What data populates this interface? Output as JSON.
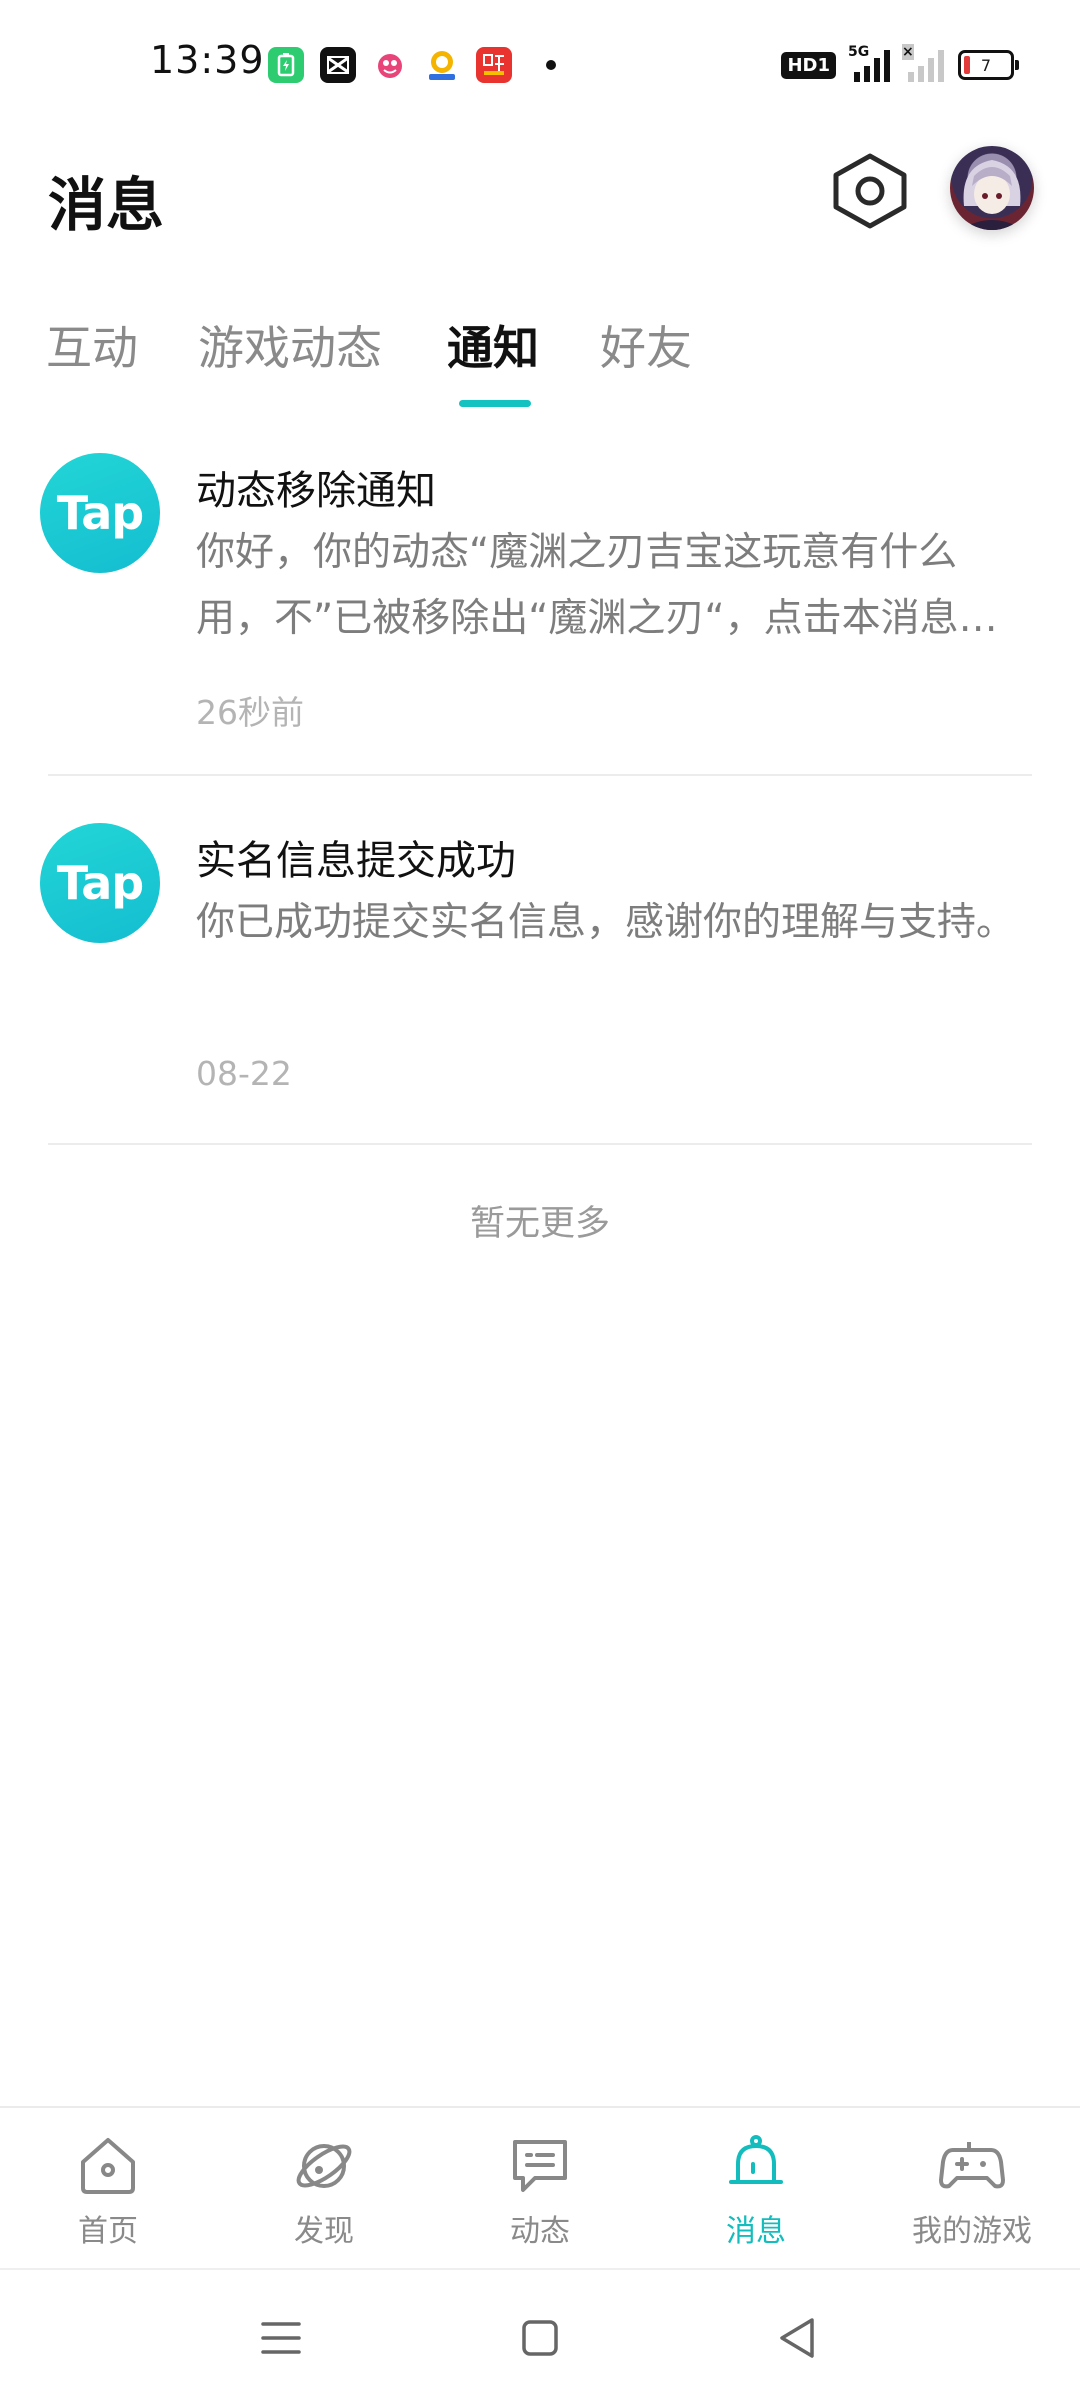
{
  "status_bar": {
    "time": "13:39",
    "network": "5G",
    "hd_label": "HD1",
    "battery_level": "7",
    "notification_icons": [
      "battery-charging-icon",
      "capcut-icon",
      "app-icon",
      "wallet-app-icon",
      "listen-app-icon"
    ]
  },
  "header": {
    "title": "消息"
  },
  "tabs": [
    {
      "label": "互动",
      "active": false
    },
    {
      "label": "游戏动态",
      "active": false
    },
    {
      "label": "通知",
      "active": true
    },
    {
      "label": "好友",
      "active": false
    }
  ],
  "messages": [
    {
      "avatar_text": "Tap",
      "title": "动态移除通知",
      "body": "你好，你的动态“魔渊之刃吉宝这玩意有什么用，不”已被移除出“魔渊之刃“，点击本消息查看详情",
      "time": "26秒前"
    },
    {
      "avatar_text": "Tap",
      "title": "实名信息提交成功",
      "body": "你已成功提交实名信息，感谢你的理解与支持。",
      "time": "08-22"
    }
  ],
  "no_more_text": "暂无更多",
  "bottom_nav": [
    {
      "label": "首页",
      "icon": "home-icon",
      "active": false
    },
    {
      "label": "发现",
      "icon": "planet-icon",
      "active": false
    },
    {
      "label": "动态",
      "icon": "chat-bubble-icon",
      "active": false
    },
    {
      "label": "消息",
      "icon": "bell-icon",
      "active": true
    },
    {
      "label": "我的游戏",
      "icon": "gamepad-icon",
      "active": false
    }
  ],
  "colors": {
    "accent": "#14bdbd",
    "tap_brand": "#18c8d4",
    "inactive_text": "#8a8a8a"
  }
}
